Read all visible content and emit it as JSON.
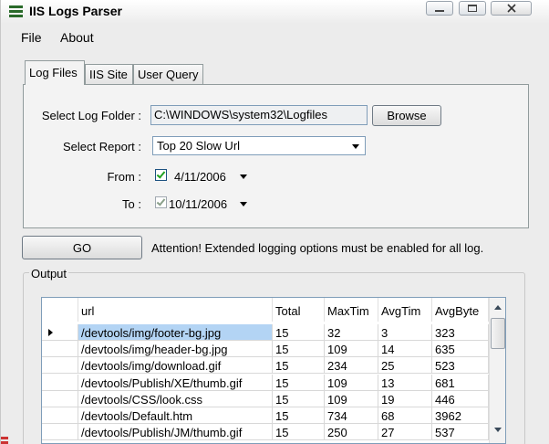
{
  "window": {
    "title": "IIS Logs Parser"
  },
  "menu": {
    "items": [
      "File",
      "About"
    ]
  },
  "tabs": [
    "Log Files",
    "IIS Site",
    "User Query"
  ],
  "form": {
    "log_folder_label": "Select Log Folder :",
    "log_folder_value": "C:\\WINDOWS\\system32\\Logfiles",
    "browse_label": "Browse",
    "report_label": "Select Report :",
    "report_value": "Top 20 Slow Url",
    "from_label": "From :",
    "from_date": "4/11/2006",
    "from_checked": true,
    "to_label": "To :",
    "to_date": "10/11/2006",
    "to_checked": true
  },
  "go_label": "GO",
  "attention": "Attention! Extended logging options must be enabled for all log.",
  "output": {
    "label": "Output",
    "columns": [
      "url",
      "Total",
      "MaxTim",
      "AvgTim",
      "AvgByte"
    ],
    "rows": [
      [
        "/devtools/img/footer-bg.jpg",
        "15",
        "32",
        "3",
        "323"
      ],
      [
        "/devtools/img/header-bg.jpg",
        "15",
        "109",
        "14",
        "635"
      ],
      [
        "/devtools/img/download.gif",
        "15",
        "234",
        "25",
        "523"
      ],
      [
        "/devtools/Publish/XE/thumb.gif",
        "15",
        "109",
        "13",
        "681"
      ],
      [
        "/devtools/CSS/look.css",
        "15",
        "109",
        "19",
        "446"
      ],
      [
        "/devtools/Default.htm",
        "15",
        "734",
        "68",
        "3962"
      ],
      [
        "/devtools/Publish/JM/thumb.gif",
        "15",
        "250",
        "27",
        "537"
      ]
    ]
  },
  "colors": {
    "selected_row": "#b3d4f4",
    "check_mark": "#21a121"
  }
}
